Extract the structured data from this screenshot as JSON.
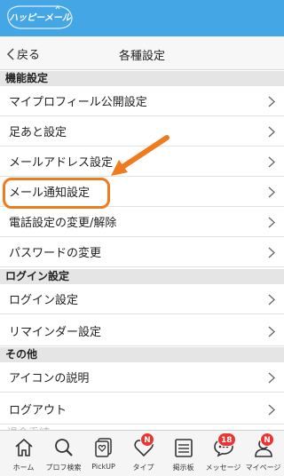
{
  "header": {
    "logo_text": "ハッピーメール",
    "brand_color": "#45a6e6"
  },
  "navbar": {
    "back_label": "戻る",
    "title": "各種設定"
  },
  "sections": {
    "function": {
      "title": "機能設定",
      "items": [
        "マイプロフィール公開設定",
        "足あと設定",
        "メールアドレス設定",
        "メール通知設定",
        "電話設定の変更/解除",
        "パスワードの変更"
      ]
    },
    "login": {
      "title": "ログイン設定",
      "items": [
        "ログイン設定",
        "リマインダー設定"
      ]
    },
    "other": {
      "title": "その他",
      "items": [
        "アイコンの説明",
        "ログアウト"
      ]
    }
  },
  "annotation": {
    "highlight_color": "#f07a1e"
  },
  "faded_text": "退会手続",
  "tabbar": {
    "tabs": [
      {
        "label": "ホーム",
        "icon": "home-icon"
      },
      {
        "label": "プロフ検索",
        "icon": "search-icon"
      },
      {
        "label": "PickUP",
        "icon": "pickup-icon"
      },
      {
        "label": "タイプ",
        "icon": "heart-icon",
        "badge": "N"
      },
      {
        "label": "掲示板",
        "icon": "board-icon"
      },
      {
        "label": "メッセージ",
        "icon": "message-icon",
        "badge": "18"
      },
      {
        "label": "マイページ",
        "icon": "person-icon",
        "badge": "N"
      }
    ]
  }
}
